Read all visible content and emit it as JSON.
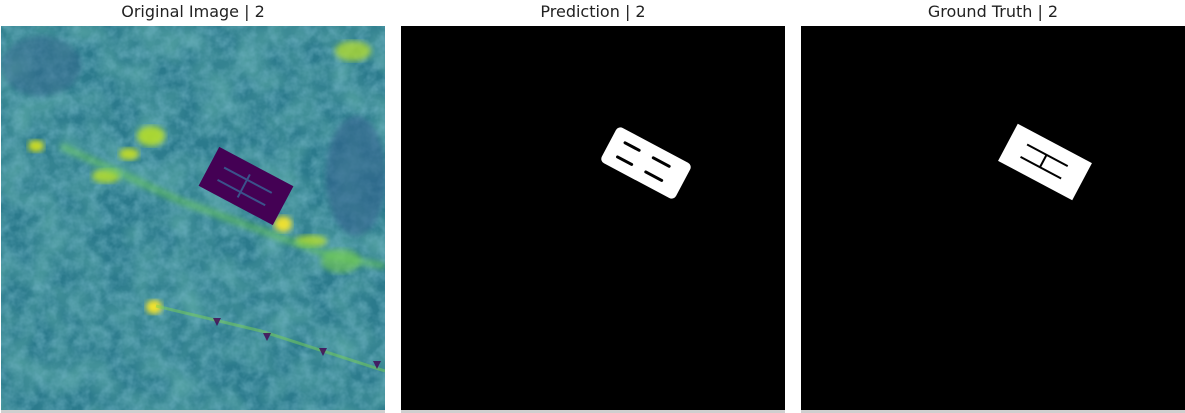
{
  "panels": [
    {
      "title": "Original Image | 2",
      "kind": "original"
    },
    {
      "title": "Prediction | 2",
      "kind": "mask-prediction"
    },
    {
      "title": "Ground Truth | 2",
      "kind": "mask-ground-truth"
    }
  ],
  "colors": {
    "viridis_dark": "#440154",
    "viridis_mid": "#21918c",
    "viridis_teal": "#2a7f8e",
    "viridis_green": "#35b779",
    "viridis_yellow": "#fde725",
    "mask_background": "#000000",
    "mask_foreground": "#ffffff"
  }
}
